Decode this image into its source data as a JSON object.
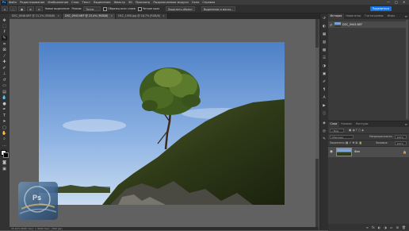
{
  "app": {
    "logo": "Ps",
    "menu": [
      "Файл",
      "Редактирование",
      "Изображение",
      "Слои",
      "Текст",
      "Выделение",
      "Фильтр",
      "3D",
      "Просмотр",
      "Подключаемые модули",
      "Окно",
      "Справка"
    ],
    "window_controls": [
      "—",
      "□",
      "✕"
    ]
  },
  "options": {
    "sample_label": "Новое выделение",
    "feather_label": "Режим:",
    "feather_value": "Точно",
    "sample_all_layers": "Образец всех слоев",
    "enhance_edge": "Четкие края",
    "select_subject": "Выделить объект",
    "select_and_mask": "Выделение и маска...",
    "share": "Поделиться"
  },
  "tabs": [
    {
      "label": "DSC_0946.NEF @ 21,2% (RGB/8)"
    },
    {
      "label": "DSC_0943.NEF @ 23,4% (RGB/8)"
    },
    {
      "label": "DSC_1950.jpg @ 16,7% (RGB/8)"
    }
  ],
  "status": "23,41%  6000 пикс. x 4000 пикс. (300 ppi)",
  "history_panel": {
    "tabs": [
      "История",
      "Навигатор",
      "Гистограмма",
      "Инфо"
    ],
    "snapshot_label": "DSC_0943.NEF"
  },
  "layers_panel": {
    "tabs": [
      "Слои",
      "Каналы",
      "Контуры"
    ],
    "kind_label": "Вид",
    "blend_mode": "Обычные",
    "opacity_label": "Непрозрачность:",
    "opacity_value": "100%",
    "lock_label": "Закрепить:",
    "fill_label": "Заливка:",
    "fill_value": "100%",
    "layer_name": "Фон"
  },
  "colors": {
    "accent": "#1473e6",
    "canvas_bg": "#616161",
    "panel_bg": "#3a3a3a"
  },
  "watermark_text": "Ps"
}
